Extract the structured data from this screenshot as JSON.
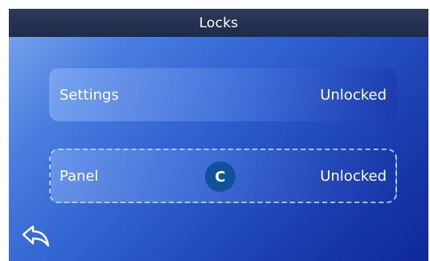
{
  "header": {
    "title": "Locks"
  },
  "locks": [
    {
      "label": "Settings",
      "status": "Unlocked"
    },
    {
      "label": "Panel",
      "status": "Unlocked",
      "badge": "C"
    }
  ],
  "navigation": {
    "back_icon": "back-arrow-icon"
  }
}
